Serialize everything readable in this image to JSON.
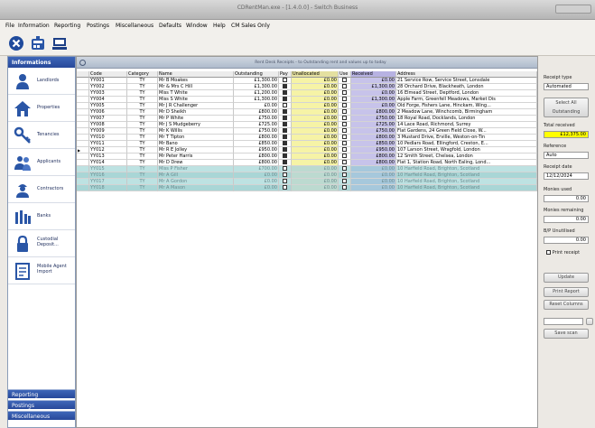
{
  "window": {
    "title": "CDRentMan.exe - [1.4.0.0] - Switch Business"
  },
  "menu": [
    "File",
    "Information",
    "Reporting",
    "Postings",
    "Miscellaneous",
    "Defaults",
    "Window",
    "Help",
    "CM Sales Only"
  ],
  "sidebar": {
    "header": "Informations",
    "items": [
      {
        "label": "Landlords",
        "icon": "person-icon"
      },
      {
        "label": "Properties",
        "icon": "house-icon"
      },
      {
        "label": "Tenancies",
        "icon": "keys-icon"
      },
      {
        "label": "Applicants",
        "icon": "people-icon"
      },
      {
        "label": "Contractors",
        "icon": "worker-icon"
      },
      {
        "label": "Banks",
        "icon": "bank-icon"
      },
      {
        "label": "Custodial Deposit...",
        "icon": "lock-icon"
      },
      {
        "label": "Mobile Agent Import",
        "icon": "notepad-icon"
      }
    ],
    "footer": [
      "Reporting",
      "Postings",
      "Miscellaneous"
    ]
  },
  "grid": {
    "header": "Rent Desk Receipts - to Outstanding rent and values up to today",
    "columns": [
      "Code",
      "Category",
      "Name",
      "Outstanding",
      "Pay",
      "Unallocated",
      "Use",
      "Received",
      "Address"
    ],
    "rows": [
      {
        "code": "YY001",
        "cat": "TY",
        "name": "Mr B Moakes",
        "out": "£1,300.00",
        "pay": false,
        "unal": "£0.00",
        "use": false,
        "rec": "£0.00",
        "addr": "21 Service Row, Service Street, Lonsdale"
      },
      {
        "code": "YY002",
        "cat": "TY",
        "name": "Mr & Mrs C Hill",
        "out": "£1,300.00",
        "pay": true,
        "unal": "£0.00",
        "use": false,
        "rec": "£1,300.00",
        "addr": "28 Orchard Drive, Blackheath, London"
      },
      {
        "code": "YY003",
        "cat": "TY",
        "name": "Miss T White",
        "out": "£1,200.00",
        "pay": true,
        "unal": "£0.00",
        "use": false,
        "rec": "£0.00",
        "addr": "16 Elmead Street, Deptford, London"
      },
      {
        "code": "YY004",
        "cat": "TY",
        "name": "Miss S White",
        "out": "£1,300.00",
        "pay": true,
        "unal": "£0.00",
        "use": false,
        "rec": "£1,300.00",
        "addr": "Apple Farm, Greenfell Meadows, Market Dis"
      },
      {
        "code": "YY005",
        "cat": "TY",
        "name": "Mr J R Challenger",
        "out": "£0.00",
        "pay": false,
        "unal": "£0.00",
        "use": false,
        "rec": "£0.00",
        "addr": "Old Forge, Fishers Lane, Hinckam, Wing..."
      },
      {
        "code": "YY006",
        "cat": "TY",
        "name": "Mr D Sheikh",
        "out": "£800.00",
        "pay": true,
        "unal": "£0.00",
        "use": false,
        "rec": "£800.00",
        "addr": "2 Meadow Lane, Winchcomb, Birmingham"
      },
      {
        "code": "YY007",
        "cat": "TY",
        "name": "Mr P White",
        "out": "£750.00",
        "pay": true,
        "unal": "£0.00",
        "use": false,
        "rec": "£750.00",
        "addr": "18 Royal Road, Docklands, London"
      },
      {
        "code": "YY008",
        "cat": "TY",
        "name": "Mr J S Mudgeberry",
        "out": "£725.00",
        "pay": true,
        "unal": "£0.00",
        "use": false,
        "rec": "£725.00",
        "addr": "14 Lace Road, Richmond, Surrey"
      },
      {
        "code": "YY009",
        "cat": "TY",
        "name": "Mr K Willis",
        "out": "£750.00",
        "pay": true,
        "unal": "£0.00",
        "use": false,
        "rec": "£750.00",
        "addr": "Flat Gardens, 24 Green Field Close, W..."
      },
      {
        "code": "YY010",
        "cat": "TY",
        "name": "Mr T Tipton",
        "out": "£800.00",
        "pay": true,
        "unal": "£0.00",
        "use": false,
        "rec": "£800.00",
        "addr": "3 Mustard Drive, Erville, Weston-on-Tin"
      },
      {
        "code": "YY011",
        "cat": "TY",
        "name": "Mr Bano",
        "out": "£850.00",
        "pay": true,
        "unal": "£0.00",
        "use": false,
        "rec": "£850.00",
        "addr": "10 Pedlars Road, Ellingford, Creston, E..."
      },
      {
        "code": "YY012",
        "cat": "TY",
        "name": "Mr R E Jolley",
        "out": "£950.00",
        "pay": true,
        "unal": "£0.00",
        "use": false,
        "rec": "£950.00",
        "addr": "107 Larson Street, Wragfold, London"
      },
      {
        "code": "YY013",
        "cat": "TY",
        "name": "Mr Peter Harris",
        "out": "£800.00",
        "pay": true,
        "unal": "£0.00",
        "use": false,
        "rec": "£800.00",
        "addr": "12 Smith Street, Chelsea, London"
      },
      {
        "code": "YY014",
        "cat": "TY",
        "name": "Mr D Drew",
        "out": "£800.00",
        "pay": true,
        "unal": "£0.00",
        "use": false,
        "rec": "£800.00",
        "addr": "Flat 1, Station Road, North Ealing, Lond..."
      },
      {
        "code": "YY015",
        "cat": "TY",
        "name": "Miss P Fisher",
        "out": "£700.00",
        "pay": false,
        "unal": "£0.00",
        "use": false,
        "rec": "£0.00",
        "addr": "10 Harfield Road, Brighton, Scotland"
      },
      {
        "code": "YY016",
        "cat": "TY",
        "name": "Mr A Gill",
        "out": "£0.00",
        "pay": false,
        "unal": "£0.00",
        "use": false,
        "rec": "£0.00",
        "addr": "10 Harfield Road, Brighton, Scotland"
      },
      {
        "code": "YY017",
        "cat": "TY",
        "name": "Mr A Gordon",
        "out": "£0.00",
        "pay": false,
        "unal": "£0.00",
        "use": false,
        "rec": "£0.00",
        "addr": "10 Harfield Road, Brighton, Scotland"
      },
      {
        "code": "YY018",
        "cat": "TY",
        "name": "Mr A Mason",
        "out": "£0.00",
        "pay": false,
        "unal": "£0.00",
        "use": false,
        "rec": "£0.00",
        "addr": "10 Harfield Road, Brighton, Scotland"
      }
    ]
  },
  "side": {
    "receipt_type_label": "Receipt type",
    "receipt_type_value": "Automated",
    "select_all": "Select All Outstanding",
    "total_label": "Total received",
    "total_value": "£12,375.00",
    "reference_label": "Reference",
    "reference_value": "Auto",
    "receipt_date_label": "Receipt date",
    "receipt_date_value": "12/12/2024",
    "monies_used_label": "Monies used",
    "monies_used_value": "0.00",
    "monies_remaining_label": "Monies remaining",
    "monies_remaining_value": "0.00",
    "bp_unutilised_label": "B/P Unutilised",
    "bp_unutilised_value": "0.00",
    "print_receipt": "Print receipt",
    "update_btn": "Update",
    "print_report_btn": "Print Report",
    "reset_columns_btn": "Reset Columns",
    "save_scan_btn": "Save scan",
    "highlight": "#ffff00"
  }
}
